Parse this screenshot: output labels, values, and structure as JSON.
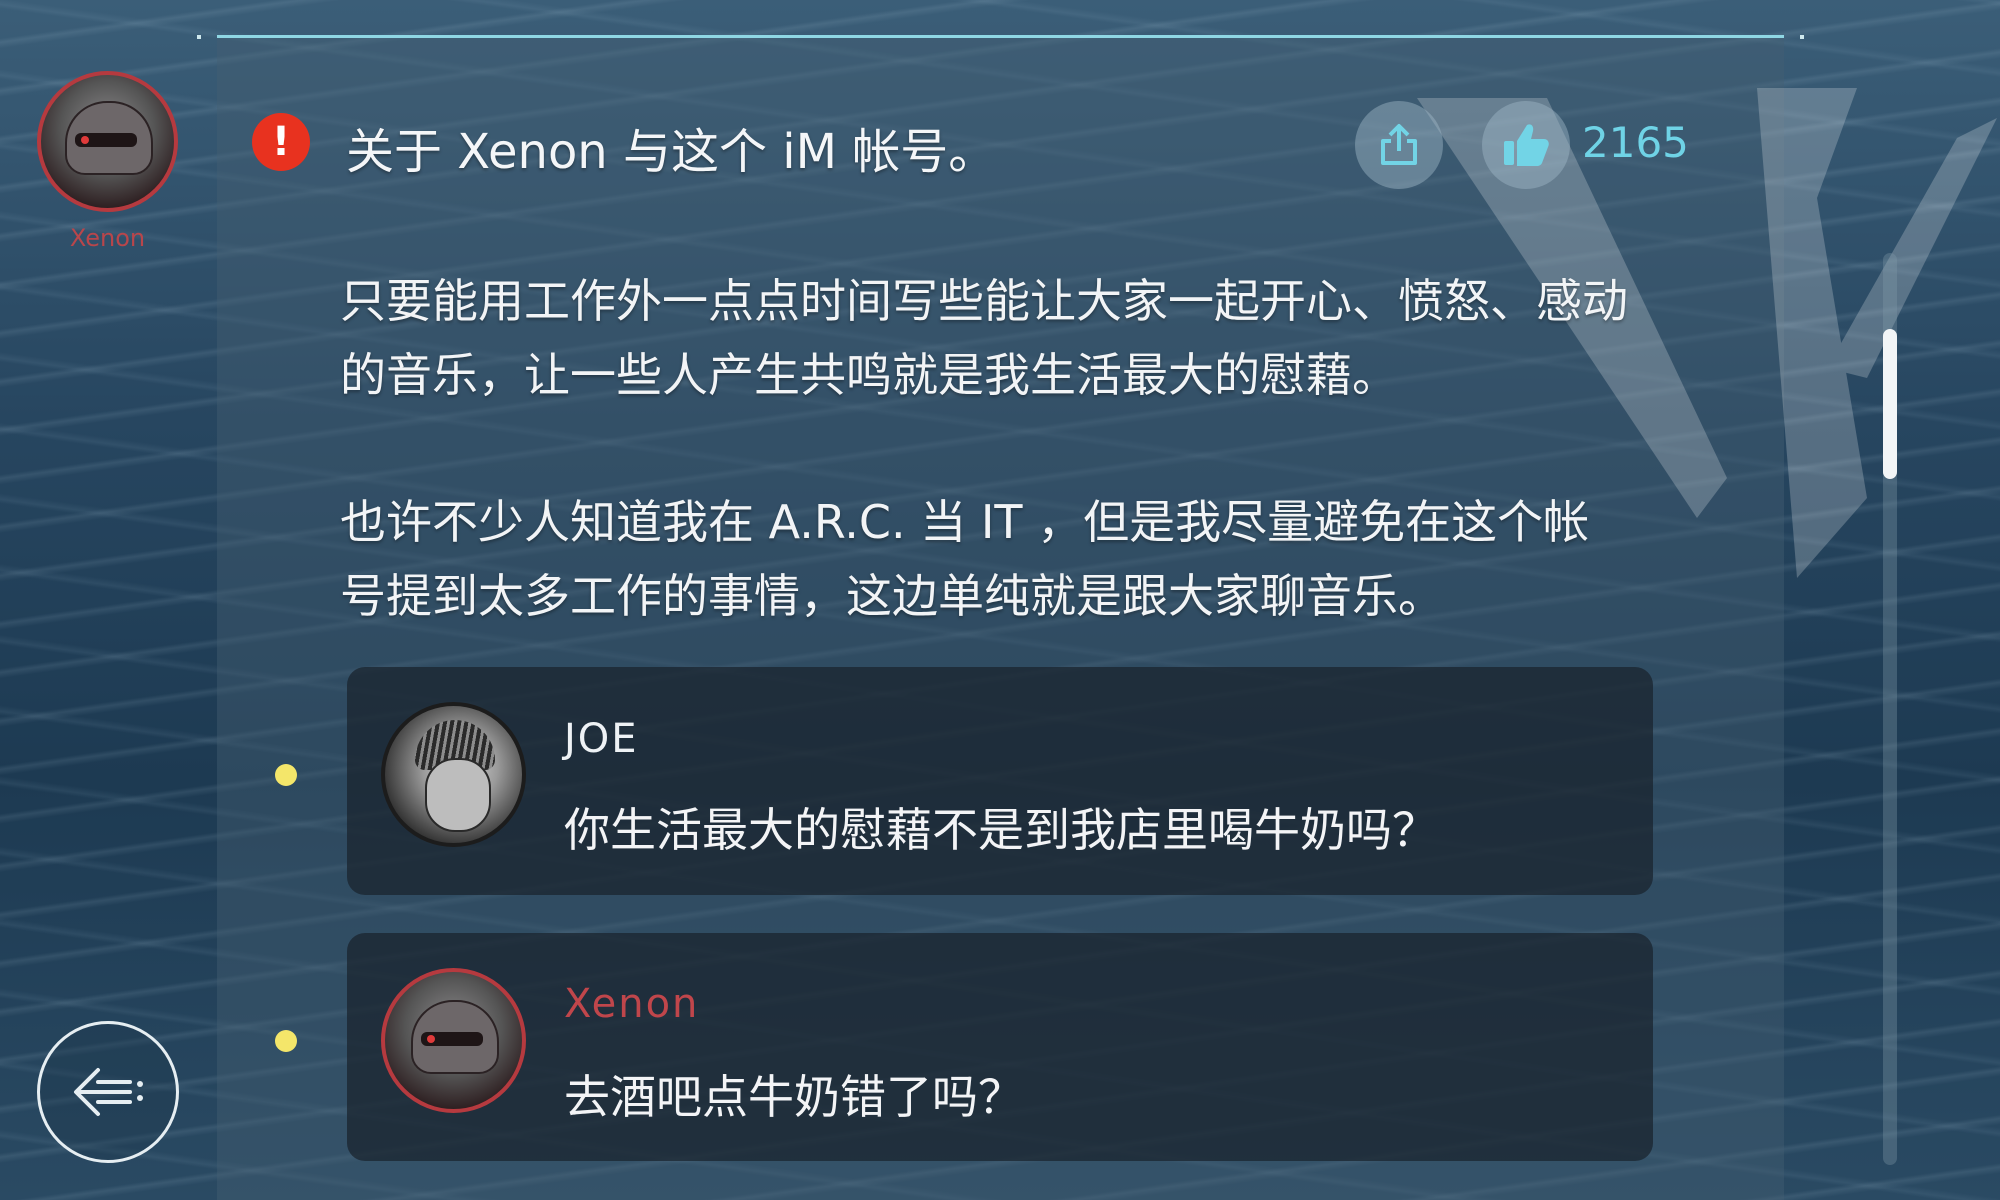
{
  "author": {
    "name": "Xenon"
  },
  "post": {
    "title": "关于 Xenon 与这个 iM 帐号。",
    "like_count": "2165",
    "paragraphs": [
      "只要能用工作外一点点时间写些能让大家一起开心、愤怒、感动的音乐，让一些人产生共鸣就是我生活最大的慰藉。",
      "也许不少人知道我在 A.R.C. 当 IT ，但是我尽量避免在这个帐号提到太多工作的事情，这边单纯就是跟大家聊音乐。"
    ]
  },
  "comments": [
    {
      "name": "JOE",
      "text": "你生活最大的慰藉不是到我店里喝牛奶吗？"
    },
    {
      "name": "Xenon",
      "text": "去酒吧点牛奶错了吗？"
    }
  ],
  "colors": {
    "accent_cyan": "#6fd3e6",
    "alert_red": "#e8321f",
    "xenon_red": "#c0464b",
    "unread_dot": "#f4e66a"
  },
  "icons": {
    "alert": "exclamation-icon",
    "share": "share-icon",
    "like": "thumbs-up-icon",
    "back": "back-arrow-icon"
  }
}
